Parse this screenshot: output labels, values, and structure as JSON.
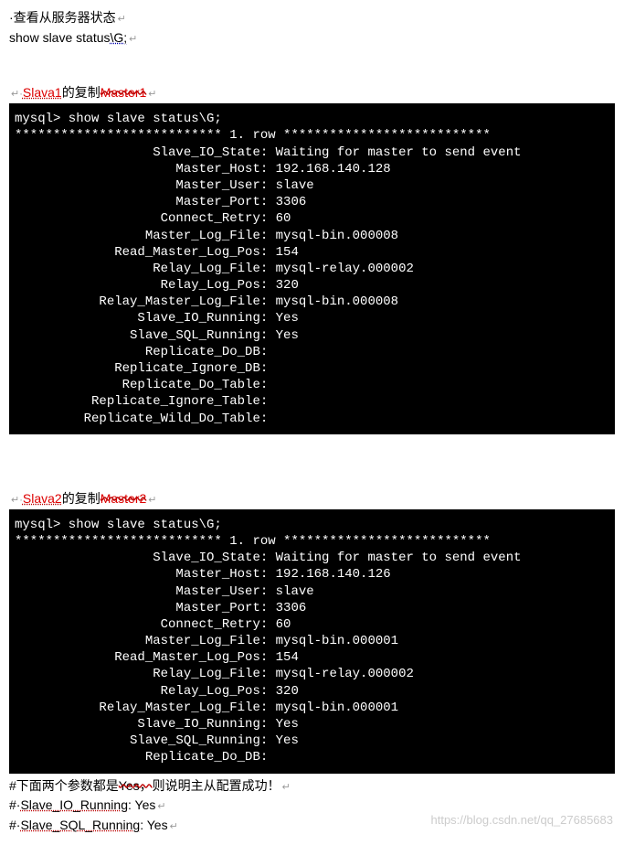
{
  "intro": {
    "line1": "·查看从服务器状态",
    "line2_prefix": "show slave status",
    "line2_suffix": "\\G;",
    "para_mark": "↵"
  },
  "section1": {
    "prefix_small": "↵·",
    "slava": "Slava1",
    "mid": "的复制",
    "master_wavy": "Master1",
    "arrow": "↵",
    "terminal": {
      "prompt_line": "mysql> show slave status\\G;",
      "row_marker": "*************************** 1. row ***************************",
      "fields": [
        {
          "label": "Slave_IO_State:",
          "value": "Waiting for master to send event"
        },
        {
          "label": "Master_Host:",
          "value": "192.168.140.128"
        },
        {
          "label": "Master_User:",
          "value": "slave"
        },
        {
          "label": "Master_Port:",
          "value": "3306"
        },
        {
          "label": "Connect_Retry:",
          "value": "60"
        },
        {
          "label": "Master_Log_File:",
          "value": "mysql-bin.000008"
        },
        {
          "label": "Read_Master_Log_Pos:",
          "value": "154"
        },
        {
          "label": "Relay_Log_File:",
          "value": "mysql-relay.000002"
        },
        {
          "label": "Relay_Log_Pos:",
          "value": "320"
        },
        {
          "label": "Relay_Master_Log_File:",
          "value": "mysql-bin.000008"
        },
        {
          "label": "Slave_IO_Running:",
          "value": "Yes"
        },
        {
          "label": "Slave_SQL_Running:",
          "value": "Yes"
        },
        {
          "label": "Replicate_Do_DB:",
          "value": ""
        },
        {
          "label": "Replicate_Ignore_DB:",
          "value": ""
        },
        {
          "label": "Replicate_Do_Table:",
          "value": ""
        },
        {
          "label": "Replicate_Ignore_Table:",
          "value": ""
        },
        {
          "label": "Replicate_Wild_Do_Table:",
          "value": ""
        }
      ]
    }
  },
  "section2": {
    "prefix_small": "↵·",
    "slava": "Slava2",
    "mid": "的复制",
    "master_wavy": "Master2",
    "arrow": "↵",
    "terminal": {
      "prompt_line": "mysql> show slave status\\G;",
      "row_marker": "*************************** 1. row ***************************",
      "fields": [
        {
          "label": "Slave_IO_State:",
          "value": "Waiting for master to send event"
        },
        {
          "label": "Master_Host:",
          "value": "192.168.140.126"
        },
        {
          "label": "Master_User:",
          "value": "slave"
        },
        {
          "label": "Master_Port:",
          "value": "3306"
        },
        {
          "label": "Connect_Retry:",
          "value": "60"
        },
        {
          "label": "Master_Log_File:",
          "value": "mysql-bin.000001"
        },
        {
          "label": "Read_Master_Log_Pos:",
          "value": "154"
        },
        {
          "label": "Relay_Log_File:",
          "value": "mysql-relay.000002"
        },
        {
          "label": "Relay_Log_Pos:",
          "value": "320"
        },
        {
          "label": "Relay_Master_Log_File:",
          "value": "mysql-bin.000001"
        },
        {
          "label": "Slave_IO_Running:",
          "value": "Yes"
        },
        {
          "label": "Slave_SQL_Running:",
          "value": "Yes"
        },
        {
          "label": "Replicate_Do_DB:",
          "value": ""
        }
      ]
    }
  },
  "footer": {
    "line1_a": "#下面两个参数都是",
    "line1_b": "Yes，",
    "line1_c": "则说明主从配置成功！",
    "line2_a": "#·",
    "line2_b": "Slave_IO_Running",
    "line2_c": ": Yes",
    "line3_a": "#·",
    "line3_b": "Slave_SQL_Running",
    "line3_c": ": Yes"
  },
  "watermark": "https://blog.csdn.net/qq_27685683"
}
